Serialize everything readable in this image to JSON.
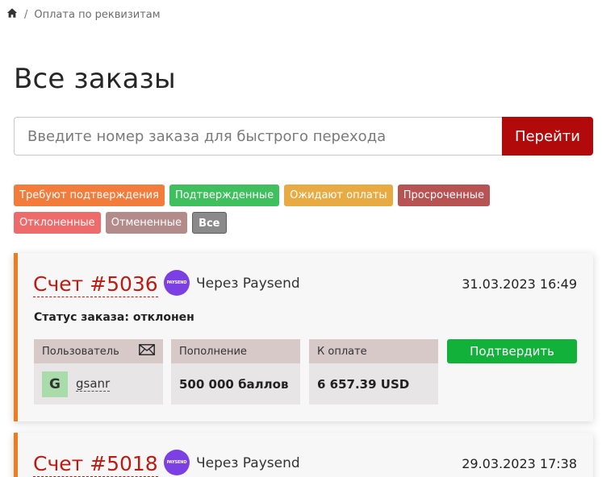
{
  "breadcrumb": {
    "home_icon": "home-icon",
    "separator": "/",
    "current": "Оплата по реквизитам"
  },
  "page": {
    "title": "Все заказы"
  },
  "search": {
    "placeholder": "Введите номер заказа для быстрого перехода",
    "value": "",
    "button_label": "Перейти",
    "button_color": "#b20a0a"
  },
  "filters": [
    {
      "label": "Требуют подтверждения",
      "color": "#f27c3c"
    },
    {
      "label": "Подтвержденные",
      "color": "#3fbf5d"
    },
    {
      "label": "Ожидают оплаты",
      "color": "#e8ab43"
    },
    {
      "label": "Просроченные",
      "color": "#b75353"
    },
    {
      "label": "Отклоненные",
      "color": "#ee6b6b"
    },
    {
      "label": "Отмененные",
      "color": "#b38b8b"
    },
    {
      "label": "Все",
      "color": "#8a8a8a"
    }
  ],
  "orders": [
    {
      "invoice": "Счет #5036",
      "payment_method": "Через Paysend",
      "payment_logo_text": "PAYSEND",
      "date": "31.03.2023 16:49",
      "status": "Статус заказа: отклонен",
      "user_label": "Пользователь",
      "user_avatar_letter": "G",
      "username": "gsanr",
      "topup_label": "Пополнение",
      "topup_value": "500 000 баллов",
      "pay_label": "К оплате",
      "pay_value": "6 657.39 USD",
      "confirm_label": "Подтвердить"
    },
    {
      "invoice": "Счет #5018",
      "payment_method": "Через Paysend",
      "payment_logo_text": "PAYSEND",
      "date": "29.03.2023 17:38"
    }
  ],
  "colors": {
    "accent_red": "#bf1a12",
    "card_border": "#f07a1e",
    "confirm_green": "#12b13a",
    "paysend_purple": "#7b3fe4"
  }
}
